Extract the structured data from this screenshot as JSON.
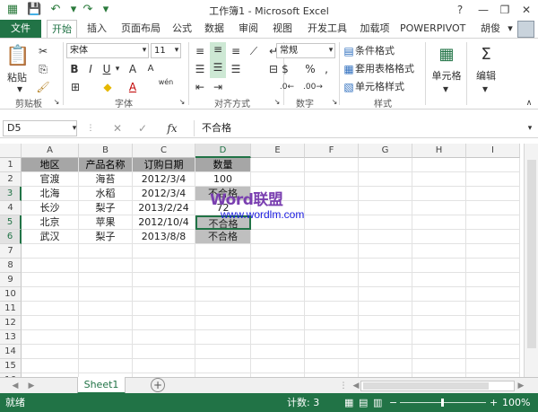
{
  "titlebar": {
    "title": "工作簿1 - Microsoft Excel",
    "help": "?",
    "minimize": "—",
    "restore": "❐",
    "close": "✕"
  },
  "tabs": {
    "file": "文件",
    "items": [
      "开始",
      "插入",
      "页面布局",
      "公式",
      "数据",
      "审阅",
      "视图",
      "开发工具",
      "加载项",
      "POWERPIVOT"
    ],
    "user": "胡俊"
  },
  "ribbon": {
    "paste": "粘贴",
    "font_name": "宋体",
    "font_size": "11",
    "number_format": "常规",
    "cond_format": "条件格式",
    "table_format": "套用表格格式",
    "cell_style": "单元格样式",
    "cells": "单元格",
    "editing": "编辑",
    "groups": {
      "clipboard": "剪贴板",
      "font": "字体",
      "alignment": "对齐方式",
      "number": "数字",
      "styles": "样式"
    },
    "phonetic": "wén"
  },
  "formula": {
    "name_box": "D5",
    "fx": "fx",
    "value": "不合格"
  },
  "grid": {
    "columns": [
      "A",
      "B",
      "C",
      "D",
      "E",
      "F",
      "G",
      "H",
      "I"
    ],
    "rows": [
      "1",
      "2",
      "3",
      "4",
      "5",
      "6",
      "7",
      "8",
      "9",
      "10",
      "11",
      "12",
      "13",
      "14",
      "15",
      "16"
    ],
    "header": [
      "地区",
      "产品名称",
      "订购日期",
      "数量"
    ],
    "data": [
      [
        "官渡",
        "海苔",
        "2012/3/4",
        "100"
      ],
      [
        "北海",
        "水稻",
        "2012/3/4",
        "不合格"
      ],
      [
        "长沙",
        "梨子",
        "2013/2/24",
        "72"
      ],
      [
        "北京",
        "苹果",
        "2012/10/4",
        "不合格"
      ],
      [
        "武汉",
        "梨子",
        "2013/8/8",
        "不合格"
      ]
    ]
  },
  "watermark": {
    "word": "Word联盟",
    "url": "www.wordlm.com"
  },
  "sheets": {
    "active": "Sheet1",
    "add": "+"
  },
  "status": {
    "ready": "就绪",
    "count": "计数: 3",
    "zoom": "100%"
  }
}
